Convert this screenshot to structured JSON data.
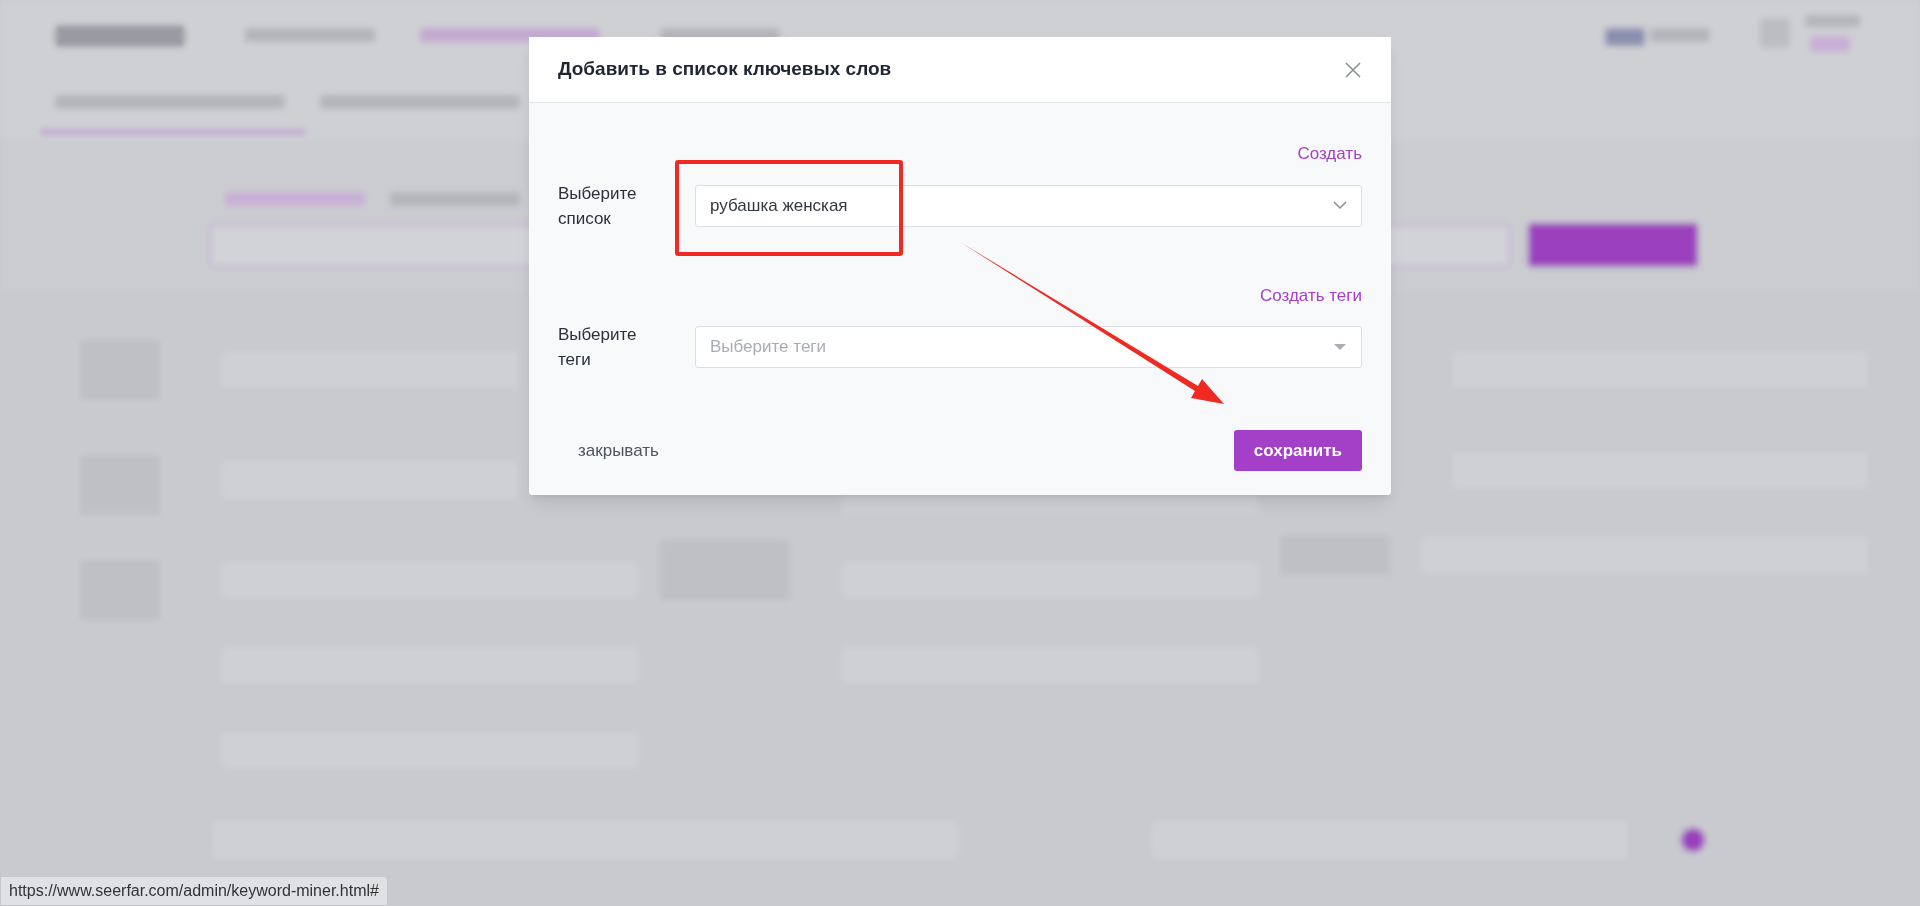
{
  "dialog": {
    "title": "Добавить в список ключевых слов",
    "fields": [
      {
        "kind": "select",
        "link": "Создать",
        "label": "Выберите список",
        "value": "рубашка женская"
      },
      {
        "kind": "tags",
        "link": "Создать теги",
        "label": "Выберите теги",
        "placeholder": "Выберите теги"
      }
    ],
    "cancel_button": "закрывать",
    "save_button": "сохранить"
  },
  "status_bar": {
    "url": "https://www.seerfar.com/admin/keyword-miner.html#"
  }
}
